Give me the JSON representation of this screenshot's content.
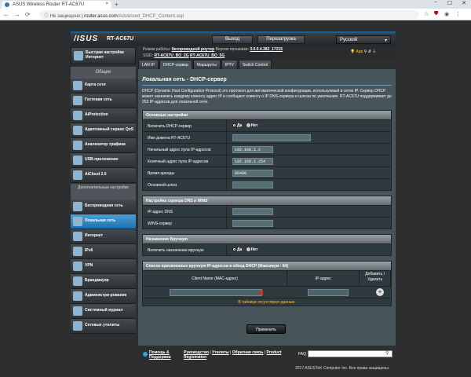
{
  "browser": {
    "tab_title": "ASUS Wireless Router RT-AC67U",
    "new_tab": "+",
    "min": "−",
    "max": "☐",
    "close": "✕",
    "tab_close": "×",
    "url_prefix": "Не защищено",
    "url_host": "router.asus.com",
    "url_path": "/Advanced_DHCP_Content.asp",
    "back": "←",
    "forward": "→",
    "reload": "⟳",
    "info": "ⓘ"
  },
  "header": {
    "logo": "/ISUS",
    "model": "RT-AC67U",
    "logout": "Выход",
    "reboot": "Перезагрузка",
    "language": "Русский",
    "mode_label": "Режим работы:",
    "mode_value": "беспроводной роутер",
    "firmware_label": "Версия прошивки:",
    "firmware_value": "3.0.0.4.382_17215",
    "ssid_label": "SSID:",
    "ssid1": "RT-AC67U_BO_2G",
    "ssid2": "RT-AC67U_BO_5G",
    "app": "App"
  },
  "sidebar": {
    "quick": "Быстрая настройка Интернет",
    "general": "Общие",
    "general_items": [
      "Карта сети",
      "Гостевая сеть",
      "AiProtection",
      "Адаптивный сервис QoS",
      "Анализатор трафика",
      "USB-приложение",
      "AiCloud 2.0"
    ],
    "advanced": "Дополнительные настройки",
    "advanced_items": [
      "Беспроводная сеть",
      "Локальная сеть",
      "Интернет",
      "IPv6",
      "VPN",
      "Брандмауэр",
      "Администри-рование",
      "Системный журнал",
      "Сетевые утилиты"
    ]
  },
  "tabs": [
    "LAN IP",
    "DHCP-сервер",
    "Маршруты",
    "IPTV",
    "Switch Control"
  ],
  "main": {
    "title": "Локальная сеть - DHCP-сервер",
    "description": "DHCP (Dynamic Host Configuration Protocol) это протокол для автоматической конфигурации, используемый в сетях IP. Сервер DHCP может назначить каждому клиенту адрес IP и сообщают клиенту о IP DNS-сервера и шлюза по умолчанию. RT-AC67U поддерживает до 253 IP-адресов для локальной сети.",
    "basic_header": "Основные настройки",
    "enable_dhcp_label": "Включить DHCP-сервер",
    "yes": "Да",
    "no": "Нет",
    "domain_label": "Имя домена RT-AC67U",
    "domain_value": "",
    "start_label": "Начальный адрес пула IP-адресов",
    "start_value": "192.168.1.2",
    "end_label": "Конечный адрес пула IP-адресов",
    "end_value": "192.168.1.254",
    "lease_label": "Время аренды",
    "lease_value": "86400",
    "gateway_label": "Основной шлюз",
    "gateway_value": "",
    "dns_header": "Настройка сервера DNS и WINS",
    "dns_label": "IP-адрес DNS",
    "dns_value": "",
    "wins_label": "WINS-сервер",
    "wins_value": "",
    "manual_header": "Назначение Вручную",
    "manual_label": "Включить назначение вручную",
    "list_header": "Список присвоенных вручную IP-адресов в обход DHCP (Максимум : 64)",
    "col_mac": "Client Name (MAC-адрес)",
    "col_ip": "IP-адрес",
    "col_action": "Добавить / Удалить",
    "empty_text": "В таблице отсутствуют данные.",
    "apply": "Применить"
  },
  "footer": {
    "help": "Помощь & Поддержка",
    "manual": "Руководство",
    "utilities": "Утилиты",
    "feedback": "Обратная связь",
    "product": "Product Registration",
    "faq": "FAQ",
    "copyright": "2017 ASUSTeK Computer Inc. Все права защищены."
  }
}
